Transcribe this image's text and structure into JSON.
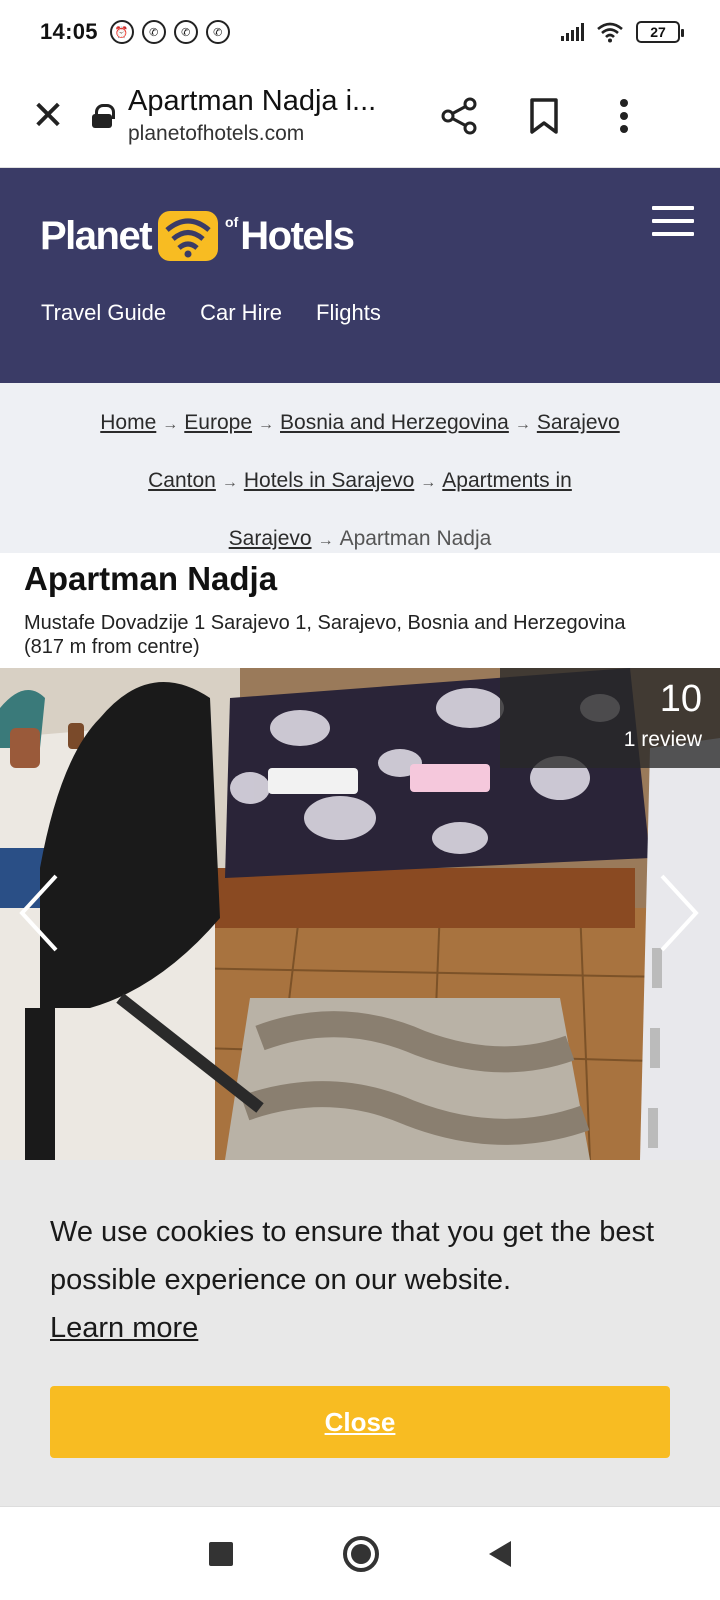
{
  "status_bar": {
    "time": "14:05",
    "battery": "27",
    "left_icons": [
      "alarm-icon",
      "viber-icon",
      "viber-icon",
      "viber-icon"
    ],
    "right_icons": [
      "signal-icon",
      "wifi-icon",
      "battery-icon"
    ]
  },
  "browser": {
    "page_title": "Apartman Nadja i...",
    "domain": "planetofhotels.com",
    "icons": [
      "close-icon",
      "lock-icon",
      "share-icon",
      "bookmark-icon",
      "more-vert-icon"
    ]
  },
  "site": {
    "logo_left": "Planet",
    "logo_of": "of",
    "logo_right": "Hotels",
    "nav": [
      "Travel Guide",
      "Car Hire",
      "Flights"
    ],
    "header_color": "#3a3b66",
    "accent_color": "#f8bc22"
  },
  "breadcrumb": {
    "separator": "→",
    "links": [
      "Home",
      "Europe",
      "Bosnia and Herzegovina",
      "Sarajevo Canton",
      "Hotels in Sarajevo",
      "Apartments in Sarajevo"
    ],
    "current": "Apartman Nadja"
  },
  "hotel": {
    "name": "Apartman Nadja",
    "address": "Mustafe Dovadzije 1 Sarajevo 1, Sarajevo, Bosnia and Herzegovina",
    "distance": "(817 m from centre)",
    "rating": "10",
    "reviews": "1 review"
  },
  "cookie": {
    "message": "We use cookies to ensure that you get the best possible experience on our website.",
    "learn_more": "Learn more",
    "close_label": "Close"
  },
  "nav_bar": {
    "icons": [
      "recents-icon",
      "home-icon",
      "back-icon"
    ]
  }
}
